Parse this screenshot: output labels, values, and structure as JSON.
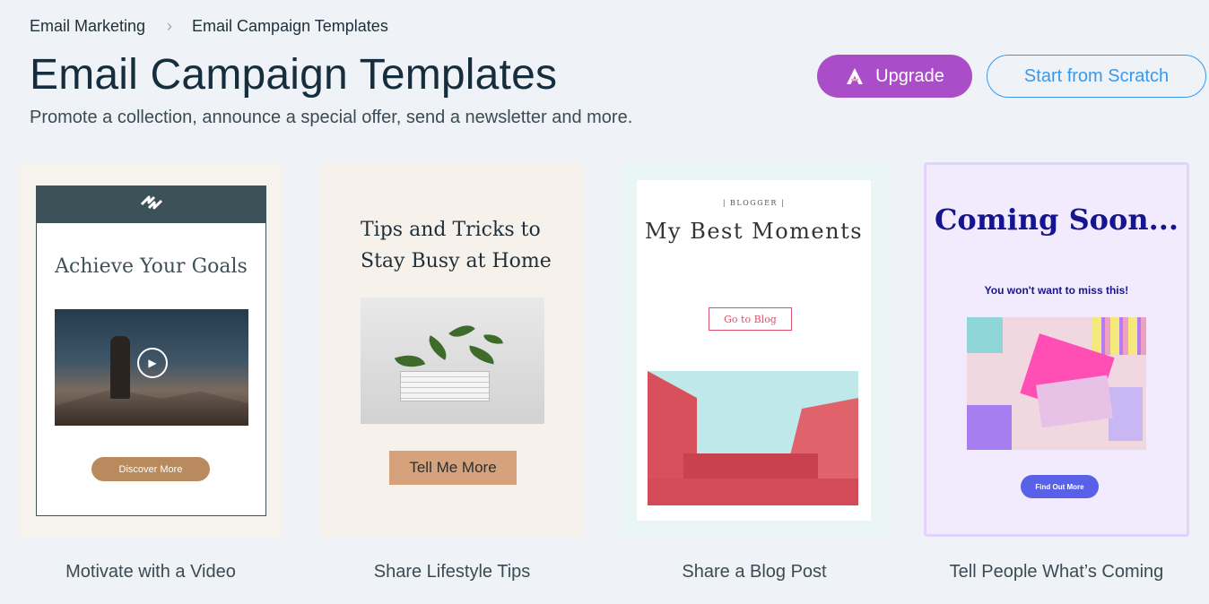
{
  "breadcrumb": {
    "parent": "Email Marketing",
    "separator": "›",
    "current": "Email Campaign Templates"
  },
  "header": {
    "title": "Email Campaign Templates",
    "subtitle": "Promote a collection, announce a special offer, send a newsletter and more.",
    "upgrade_label": "Upgrade",
    "start_scratch_label": "Start from Scratch"
  },
  "colors": {
    "upgrade": "#aa4dc8",
    "accent_blue": "#3899ec",
    "page_bg": "#eff2f6"
  },
  "templates": [
    {
      "label": "Motivate with a Video",
      "preview_heading": "Achieve Your Goals",
      "preview_button": "Discover More",
      "icons": [
        "logo-icon",
        "play-icon"
      ]
    },
    {
      "label": "Share Lifestyle Tips",
      "preview_heading": "Tips and Tricks to Stay Busy at Home",
      "preview_button": "Tell Me More"
    },
    {
      "label": "Share a Blog Post",
      "preview_tag": "| BLOGGER |",
      "preview_heading": "My Best Moments",
      "preview_button": "Go to Blog"
    },
    {
      "label": "Tell People What’s Coming",
      "preview_heading": "Coming Soon...",
      "preview_tagline": "You won't want to miss this!",
      "preview_button": "Find Out More"
    }
  ]
}
